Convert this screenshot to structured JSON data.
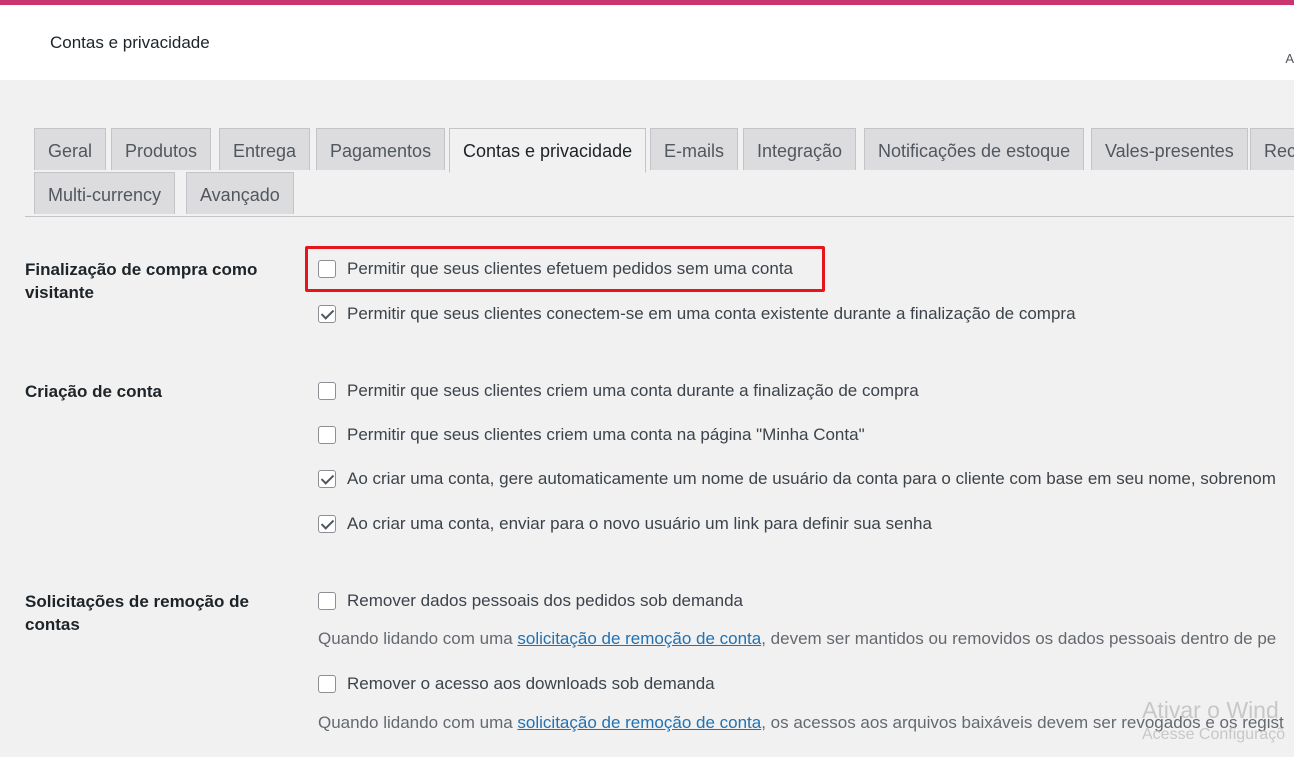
{
  "header": {
    "title": "Contas e privacidade",
    "edge_letter": "A"
  },
  "tabs": [
    {
      "label": "Geral",
      "active": false
    },
    {
      "label": "Produtos",
      "active": false
    },
    {
      "label": "Entrega",
      "active": false
    },
    {
      "label": "Pagamentos",
      "active": false
    },
    {
      "label": "Contas e privacidade",
      "active": true
    },
    {
      "label": "E-mails",
      "active": false
    },
    {
      "label": "Integração",
      "active": false
    },
    {
      "label": "Notificações de estoque",
      "active": false
    },
    {
      "label": "Vales-presentes",
      "active": false
    },
    {
      "label": "Rec",
      "active": false
    },
    {
      "label": "Multi-currency",
      "active": false
    },
    {
      "label": "Avançado",
      "active": false
    }
  ],
  "sections": {
    "guest_checkout": {
      "label": "Finalização de compra como visitante",
      "options": [
        {
          "label": "Permitir que seus clientes efetuem pedidos sem uma conta",
          "checked": false,
          "highlighted": true
        },
        {
          "label": "Permitir que seus clientes conectem-se em uma conta existente durante a finalização de compra",
          "checked": true
        }
      ]
    },
    "account_creation": {
      "label": "Criação de conta",
      "options": [
        {
          "label": "Permitir que seus clientes criem uma conta durante a finalização de compra",
          "checked": false
        },
        {
          "label": "Permitir que seus clientes criem uma conta na página \"Minha Conta\"",
          "checked": false
        },
        {
          "label": "Ao criar uma conta, gere automaticamente um nome de usuário da conta para o cliente com base em seu nome, sobrenom",
          "checked": true
        },
        {
          "label": "Ao criar uma conta, enviar para o novo usuário um link para definir sua senha",
          "checked": true
        }
      ]
    },
    "erasure_requests": {
      "label": "Solicitações de remoção de contas",
      "options": [
        {
          "label": "Remover dados pessoais dos pedidos sob demanda",
          "checked": false,
          "desc_prefix": "Quando lidando com uma ",
          "desc_link": "solicitação de remoção de conta",
          "desc_suffix": ", devem ser mantidos ou removidos os dados pessoais dentro de pe"
        },
        {
          "label": "Remover o acesso aos downloads sob demanda",
          "checked": false,
          "desc_prefix": "Quando lidando com uma ",
          "desc_link": "solicitação de remoção de conta",
          "desc_suffix": ", os acessos aos arquivos baixáveis devem ser revogados e os regist"
        }
      ]
    }
  },
  "watermark": {
    "line1": "Ativar o Wind",
    "line2": "Acesse Configuraçõ"
  },
  "colors": {
    "accent": "#c9356e",
    "highlight_border": "#e8141c",
    "link": "#2271b1"
  }
}
